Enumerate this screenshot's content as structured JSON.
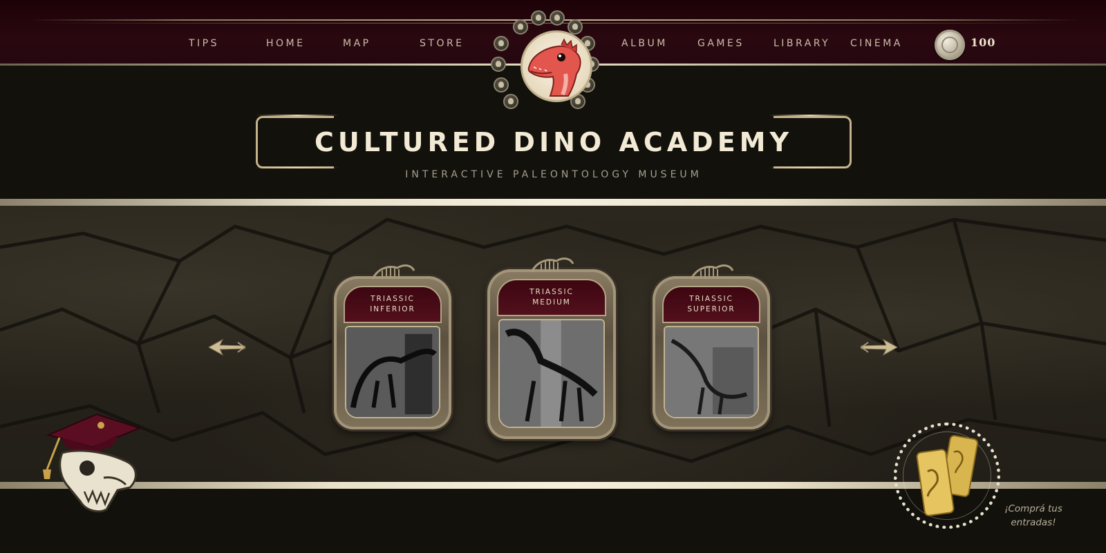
{
  "nav": {
    "left_items": [
      "TIPS",
      "HOME",
      "MAP",
      "STORE"
    ],
    "right_items": [
      "ALBUM",
      "GAMES",
      "LIBRARY",
      "CINEMA"
    ],
    "coins": "100"
  },
  "header": {
    "title": "CULTURED DINO ACADEMY",
    "subtitle": "INTERACTIVE PALEONTOLOGY MUSEUM"
  },
  "carousel": {
    "cards": [
      {
        "line1": "TRIASSIC",
        "line2": "INFERIOR"
      },
      {
        "line1": "TRIASSIC",
        "line2": "MEDIUM"
      },
      {
        "line1": "TRIASSIC",
        "line2": "SUPERIOR"
      }
    ]
  },
  "tickets": {
    "cta_line1": "¡Comprá tus",
    "cta_line2": "entradas!"
  },
  "colors": {
    "nav_bg": "#250710",
    "accent_gold": "#c5b38c",
    "card_header": "#4a0c17",
    "background": "#13110c"
  },
  "icons": {
    "coin": "coin-icon",
    "mascot": "dino-mascot-icon",
    "prev": "arrow-left-icon",
    "next": "arrow-right-icon",
    "skull": "graduation-skull-icon",
    "tickets": "tickets-icon"
  }
}
